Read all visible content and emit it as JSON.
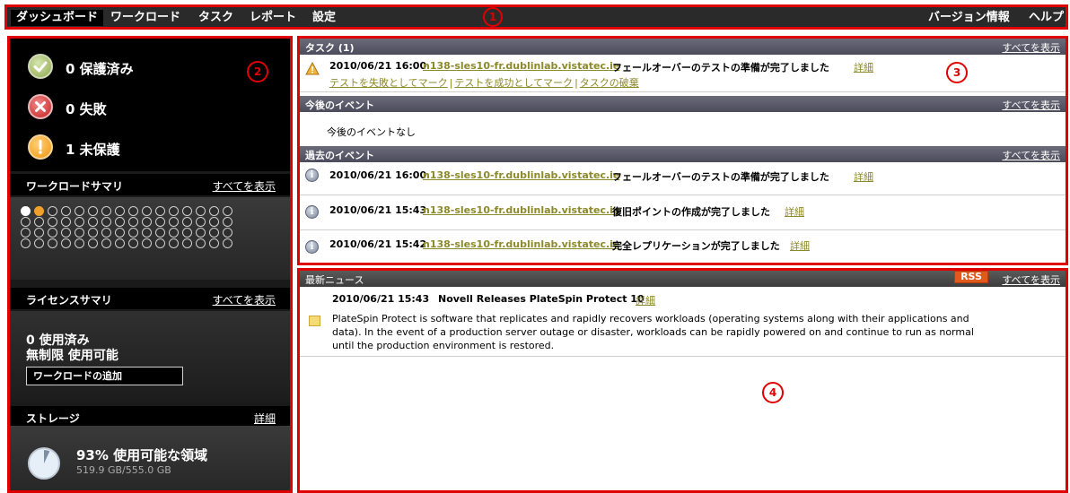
{
  "nav": {
    "dashboard": "ダッシュボード",
    "workload": "ワークロード",
    "task": "タスク",
    "report": "レポート",
    "settings": "設定",
    "version": "バージョン情報",
    "help": "ヘルプ"
  },
  "callouts": {
    "one": "1",
    "two": "2",
    "three": "3",
    "four": "4"
  },
  "status": {
    "protected": "0 保護済み",
    "failed": "0 失敗",
    "unprotected": "1 未保護"
  },
  "workload_summary": {
    "title": "ワークロードサマリ",
    "view_all": "すべてを表示",
    "dots": {
      "rows": 4,
      "cols": 16,
      "last_row_cols": 16,
      "white_index": 0,
      "orange_index": 1
    }
  },
  "license_summary": {
    "title": "ライセンスサマリ",
    "view_all": "すべてを表示",
    "used": "0 使用済み",
    "available": "無制限 使用可能",
    "add_workload": "ワークロードの追加"
  },
  "storage": {
    "title": "ストレージ",
    "details": "詳細",
    "percent_text": "93% 使用可能な領域",
    "size_text": "519.9 GB/555.0 GB",
    "available_fraction": 0.93
  },
  "tasks": {
    "title": "タスク (1)",
    "view_all": "すべてを表示",
    "items": [
      {
        "time": "2010/06/21 16:00",
        "host": "n138-sles10-fr.dublinlab.vistatec.ie",
        "message": "フェールオーバーのテストの準備が完了しました",
        "details": "詳細",
        "actions": [
          "テストを失敗としてマーク",
          "テストを成功としてマーク",
          "タスクの破棄"
        ]
      }
    ]
  },
  "upcoming_events": {
    "title": "今後のイベント",
    "view_all": "すべてを表示",
    "empty": "今後のイベントなし"
  },
  "past_events": {
    "title": "過去のイベント",
    "view_all": "すべてを表示",
    "items": [
      {
        "time": "2010/06/21 16:00",
        "host": "n138-sles10-fr.dublinlab.vistatec.ie",
        "message": "フェールオーバーのテストの準備が完了しました",
        "details": "詳細"
      },
      {
        "time": "2010/06/21 15:43",
        "host": "n138-sles10-fr.dublinlab.vistatec.ie",
        "message": "復旧ポイントの作成が完了しました",
        "details": "詳細"
      },
      {
        "time": "2010/06/21 15:42",
        "host": "n138-sles10-fr.dublinlab.vistatec.ie",
        "message": "完全レプリケーションが完了しました",
        "details": "詳細"
      }
    ]
  },
  "news": {
    "title": "最新ニュース",
    "rss": "RSS",
    "view_all": "すべてを表示",
    "items": [
      {
        "time": "2010/06/21 15:43",
        "title": "Novell Releases PlateSpin Protect 10",
        "details": "詳細",
        "body": "PlateSpin Protect is software that replicates and rapidly recovers workloads (operating systems along with their applications and data). In the event of a production server outage or disaster, workloads can be rapidly powered on and continue to run as normal until the production environment is restored."
      }
    ]
  },
  "colors": {
    "accent_red": "#e00000",
    "link_olive": "#8c8a2a",
    "header_bg": "#2a2a2a"
  }
}
